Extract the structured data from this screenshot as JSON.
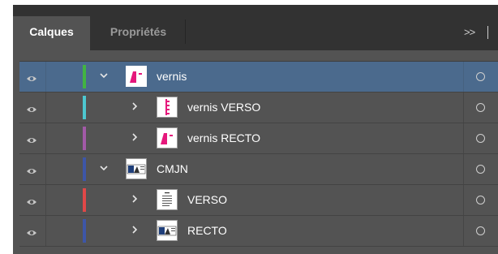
{
  "tabs": [
    {
      "label": "Calques",
      "active": true
    },
    {
      "label": "Propriétés",
      "active": false
    }
  ],
  "panel_menu_label": ">>",
  "layers": [
    {
      "name": "vernis",
      "level": 0,
      "expanded": true,
      "selected": true,
      "color": "#42b442",
      "thumb": "magenta-shape"
    },
    {
      "name": "vernis VERSO",
      "level": 1,
      "expanded": false,
      "selected": false,
      "color": "#4dc7d0",
      "thumb": "magenta-strip"
    },
    {
      "name": "vernis RECTO",
      "level": 1,
      "expanded": false,
      "selected": false,
      "color": "#a25aa8",
      "thumb": "magenta-shape"
    },
    {
      "name": "CMJN",
      "level": 0,
      "expanded": true,
      "selected": false,
      "color": "#3d56a8",
      "thumb": "print-card"
    },
    {
      "name": "VERSO",
      "level": 1,
      "expanded": false,
      "selected": false,
      "color": "#e04848",
      "thumb": "text-lines"
    },
    {
      "name": "RECTO",
      "level": 1,
      "expanded": false,
      "selected": false,
      "color": "#3d56a8",
      "thumb": "print-card"
    }
  ]
}
